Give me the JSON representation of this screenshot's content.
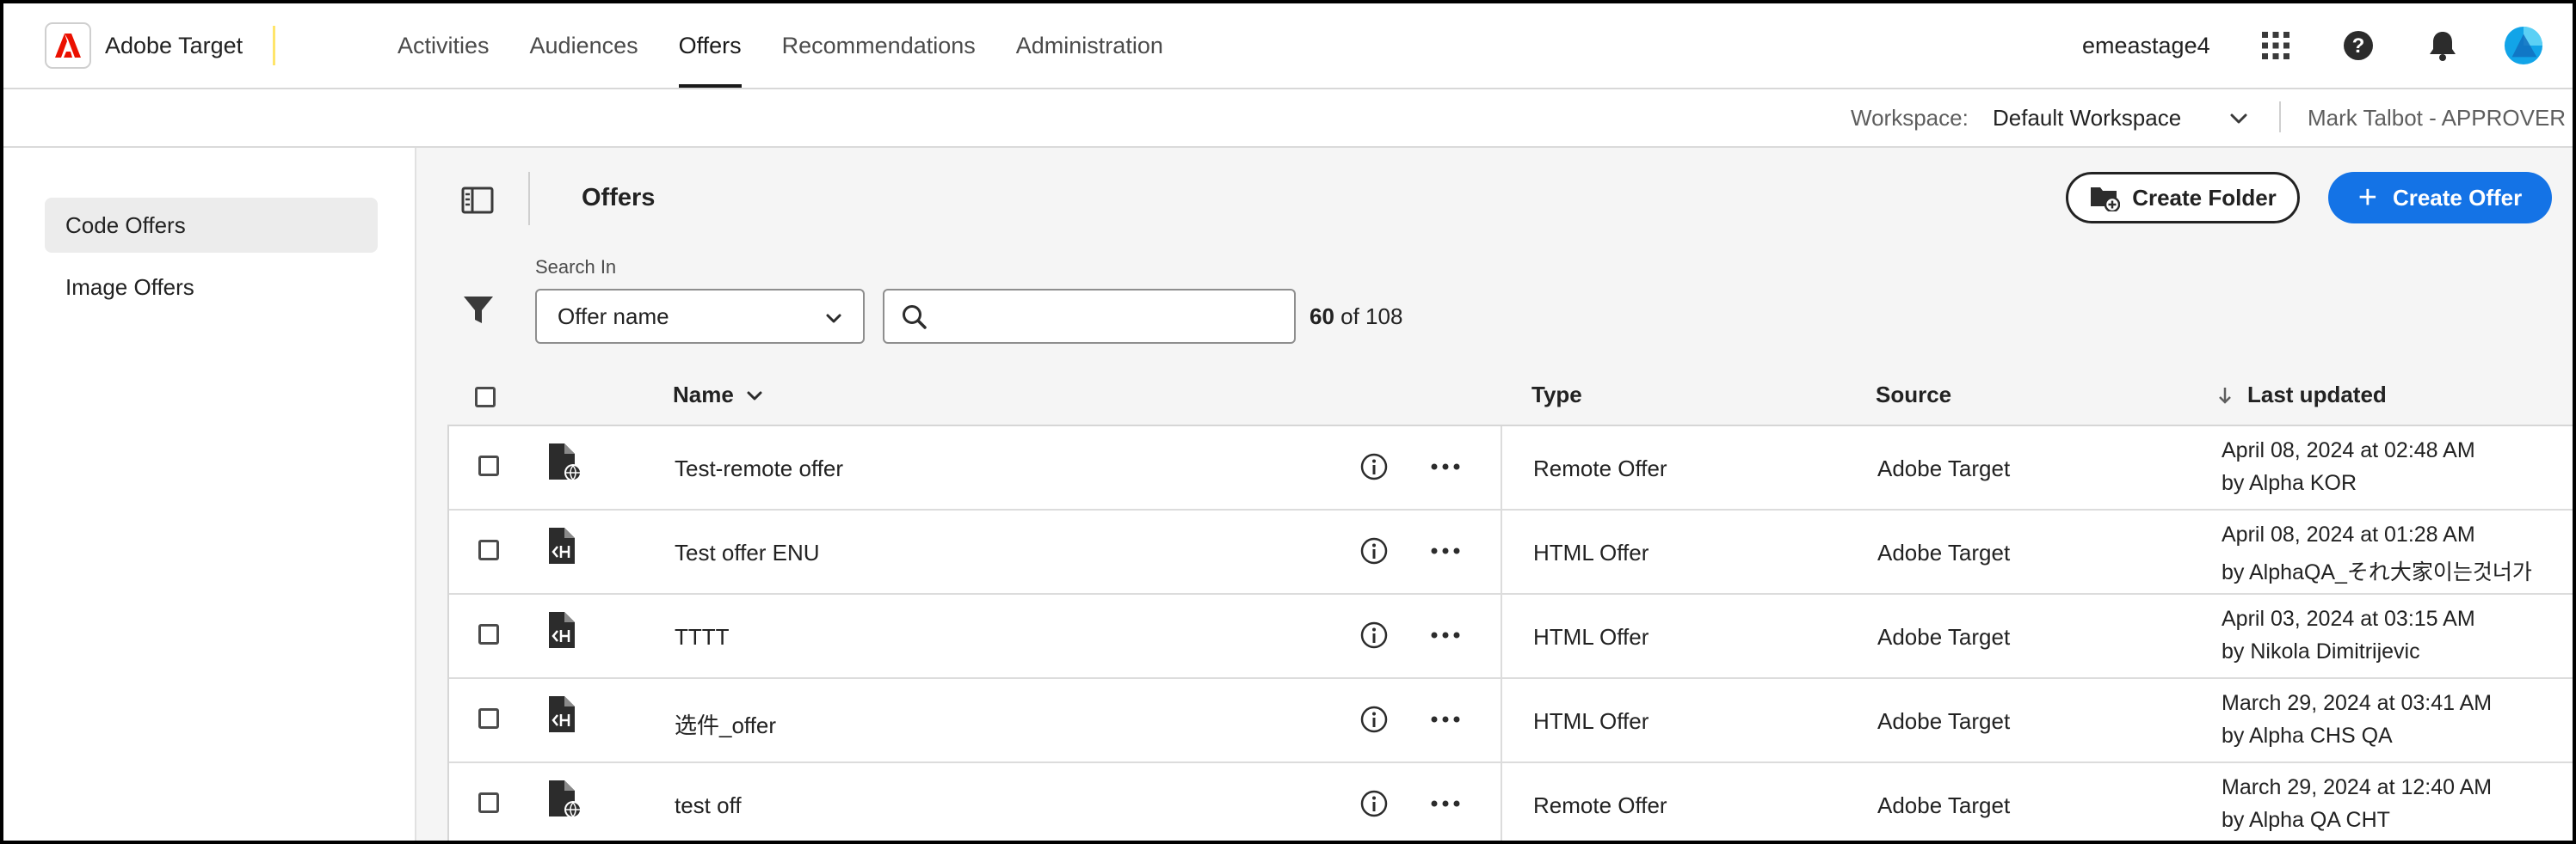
{
  "app": {
    "brand_name": "Adobe Target",
    "nav": [
      {
        "label": "Activities",
        "active": false
      },
      {
        "label": "Audiences",
        "active": false
      },
      {
        "label": "Offers",
        "active": true
      },
      {
        "label": "Recommendations",
        "active": false
      },
      {
        "label": "Administration",
        "active": false
      }
    ],
    "org_name": "emeastage4",
    "icons": [
      "apps-grid-icon",
      "help-icon",
      "notifications-bell-icon",
      "user-avatar"
    ],
    "accent_color": "#1473e6",
    "brand_color": "#eb1000"
  },
  "workspace": {
    "label": "Workspace:",
    "value": "Default Workspace",
    "user": "Mark Talbot - APPROVER"
  },
  "sidebar": {
    "items": [
      {
        "label": "Code Offers",
        "selected": true
      },
      {
        "label": "Image Offers",
        "selected": false
      }
    ]
  },
  "main": {
    "title": "Offers",
    "create_folder_label": "Create Folder",
    "create_offer_label": "Create Offer",
    "search_in_label": "Search In",
    "search_in_value": "Offer name",
    "search_placeholder": "",
    "count_shown": "60",
    "count_suffix": " of 108"
  },
  "table": {
    "headers": {
      "name": "Name",
      "type": "Type",
      "source": "Source",
      "last_updated": "Last updated"
    },
    "sort": {
      "column": "last_updated",
      "direction": "descending"
    },
    "rows": [
      {
        "icon": "remote-offer-icon",
        "name": "Test-remote offer",
        "type": "Remote Offer",
        "source": "Adobe Target",
        "updated": "April 08, 2024 at 02:48 AM",
        "by": "by Alpha KOR"
      },
      {
        "icon": "html-offer-icon",
        "name": "Test offer ENU",
        "type": "HTML Offer",
        "source": "Adobe Target",
        "updated": "April 08, 2024 at 01:28 AM",
        "by": "by AlphaQA_それ大家이는것너가"
      },
      {
        "icon": "html-offer-icon",
        "name": "TTTT",
        "type": "HTML Offer",
        "source": "Adobe Target",
        "updated": "April 03, 2024 at 03:15 AM",
        "by": "by Nikola Dimitrijevic"
      },
      {
        "icon": "html-offer-icon",
        "name": "选件_offer",
        "type": "HTML Offer",
        "source": "Adobe Target",
        "updated": "March 29, 2024 at 03:41 AM",
        "by": "by Alpha CHS QA"
      },
      {
        "icon": "remote-offer-icon",
        "name": "test off",
        "type": "Remote Offer",
        "source": "Adobe Target",
        "updated": "March 29, 2024 at 12:40 AM",
        "by": "by Alpha QA CHT"
      }
    ]
  }
}
